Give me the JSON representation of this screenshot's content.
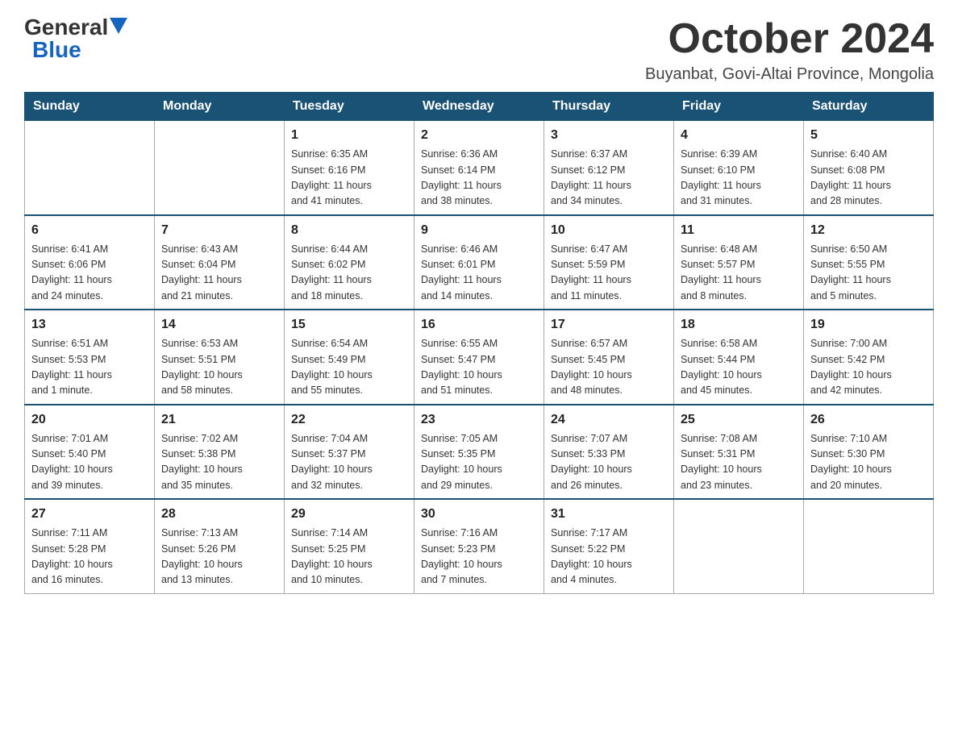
{
  "logo": {
    "general": "General",
    "blue": "Blue",
    "triangle": "▶"
  },
  "title": "October 2024",
  "location": "Buyanbat, Govi-Altai Province, Mongolia",
  "headers": [
    "Sunday",
    "Monday",
    "Tuesday",
    "Wednesday",
    "Thursday",
    "Friday",
    "Saturday"
  ],
  "weeks": [
    [
      {
        "day": "",
        "info": ""
      },
      {
        "day": "",
        "info": ""
      },
      {
        "day": "1",
        "info": "Sunrise: 6:35 AM\nSunset: 6:16 PM\nDaylight: 11 hours\nand 41 minutes."
      },
      {
        "day": "2",
        "info": "Sunrise: 6:36 AM\nSunset: 6:14 PM\nDaylight: 11 hours\nand 38 minutes."
      },
      {
        "day": "3",
        "info": "Sunrise: 6:37 AM\nSunset: 6:12 PM\nDaylight: 11 hours\nand 34 minutes."
      },
      {
        "day": "4",
        "info": "Sunrise: 6:39 AM\nSunset: 6:10 PM\nDaylight: 11 hours\nand 31 minutes."
      },
      {
        "day": "5",
        "info": "Sunrise: 6:40 AM\nSunset: 6:08 PM\nDaylight: 11 hours\nand 28 minutes."
      }
    ],
    [
      {
        "day": "6",
        "info": "Sunrise: 6:41 AM\nSunset: 6:06 PM\nDaylight: 11 hours\nand 24 minutes."
      },
      {
        "day": "7",
        "info": "Sunrise: 6:43 AM\nSunset: 6:04 PM\nDaylight: 11 hours\nand 21 minutes."
      },
      {
        "day": "8",
        "info": "Sunrise: 6:44 AM\nSunset: 6:02 PM\nDaylight: 11 hours\nand 18 minutes."
      },
      {
        "day": "9",
        "info": "Sunrise: 6:46 AM\nSunset: 6:01 PM\nDaylight: 11 hours\nand 14 minutes."
      },
      {
        "day": "10",
        "info": "Sunrise: 6:47 AM\nSunset: 5:59 PM\nDaylight: 11 hours\nand 11 minutes."
      },
      {
        "day": "11",
        "info": "Sunrise: 6:48 AM\nSunset: 5:57 PM\nDaylight: 11 hours\nand 8 minutes."
      },
      {
        "day": "12",
        "info": "Sunrise: 6:50 AM\nSunset: 5:55 PM\nDaylight: 11 hours\nand 5 minutes."
      }
    ],
    [
      {
        "day": "13",
        "info": "Sunrise: 6:51 AM\nSunset: 5:53 PM\nDaylight: 11 hours\nand 1 minute."
      },
      {
        "day": "14",
        "info": "Sunrise: 6:53 AM\nSunset: 5:51 PM\nDaylight: 10 hours\nand 58 minutes."
      },
      {
        "day": "15",
        "info": "Sunrise: 6:54 AM\nSunset: 5:49 PM\nDaylight: 10 hours\nand 55 minutes."
      },
      {
        "day": "16",
        "info": "Sunrise: 6:55 AM\nSunset: 5:47 PM\nDaylight: 10 hours\nand 51 minutes."
      },
      {
        "day": "17",
        "info": "Sunrise: 6:57 AM\nSunset: 5:45 PM\nDaylight: 10 hours\nand 48 minutes."
      },
      {
        "day": "18",
        "info": "Sunrise: 6:58 AM\nSunset: 5:44 PM\nDaylight: 10 hours\nand 45 minutes."
      },
      {
        "day": "19",
        "info": "Sunrise: 7:00 AM\nSunset: 5:42 PM\nDaylight: 10 hours\nand 42 minutes."
      }
    ],
    [
      {
        "day": "20",
        "info": "Sunrise: 7:01 AM\nSunset: 5:40 PM\nDaylight: 10 hours\nand 39 minutes."
      },
      {
        "day": "21",
        "info": "Sunrise: 7:02 AM\nSunset: 5:38 PM\nDaylight: 10 hours\nand 35 minutes."
      },
      {
        "day": "22",
        "info": "Sunrise: 7:04 AM\nSunset: 5:37 PM\nDaylight: 10 hours\nand 32 minutes."
      },
      {
        "day": "23",
        "info": "Sunrise: 7:05 AM\nSunset: 5:35 PM\nDaylight: 10 hours\nand 29 minutes."
      },
      {
        "day": "24",
        "info": "Sunrise: 7:07 AM\nSunset: 5:33 PM\nDaylight: 10 hours\nand 26 minutes."
      },
      {
        "day": "25",
        "info": "Sunrise: 7:08 AM\nSunset: 5:31 PM\nDaylight: 10 hours\nand 23 minutes."
      },
      {
        "day": "26",
        "info": "Sunrise: 7:10 AM\nSunset: 5:30 PM\nDaylight: 10 hours\nand 20 minutes."
      }
    ],
    [
      {
        "day": "27",
        "info": "Sunrise: 7:11 AM\nSunset: 5:28 PM\nDaylight: 10 hours\nand 16 minutes."
      },
      {
        "day": "28",
        "info": "Sunrise: 7:13 AM\nSunset: 5:26 PM\nDaylight: 10 hours\nand 13 minutes."
      },
      {
        "day": "29",
        "info": "Sunrise: 7:14 AM\nSunset: 5:25 PM\nDaylight: 10 hours\nand 10 minutes."
      },
      {
        "day": "30",
        "info": "Sunrise: 7:16 AM\nSunset: 5:23 PM\nDaylight: 10 hours\nand 7 minutes."
      },
      {
        "day": "31",
        "info": "Sunrise: 7:17 AM\nSunset: 5:22 PM\nDaylight: 10 hours\nand 4 minutes."
      },
      {
        "day": "",
        "info": ""
      },
      {
        "day": "",
        "info": ""
      }
    ]
  ]
}
